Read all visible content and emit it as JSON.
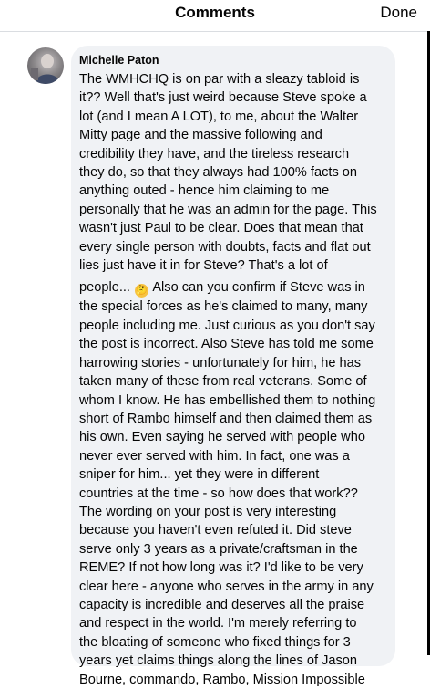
{
  "header": {
    "title": "Comments",
    "done_label": "Done"
  },
  "comment": {
    "author": "Michelle Paton",
    "lines": [
      "The WMHCHQ is on par with a sleazy tabloid is",
      "it?? Well that's just weird because Steve spoke a",
      "lot (and I mean A LOT), to me, about the Walter",
      "Mitty page and the massive following and",
      "credibility they have, and the tireless research",
      "they do, so that they always had 100% facts on",
      "anything outed - hence him claiming to me",
      "personally that he was an admin for the page. This",
      "wasn't just Paul to be clear. Does that mean that",
      "every single person with doubts, facts and flat out",
      "lies just have it in for Steve? That's a lot of"
    ],
    "line12_before": "people...",
    "emoji": "🤔",
    "line12_after": "Also can you confirm if Steve was in",
    "lines_after": [
      "the special forces as he's claimed to many, many",
      "people including me. Just curious as you don't say",
      "the post is incorrect. Also Steve has told me some",
      "harrowing stories - unfortunately for him, he has",
      "taken many of these from real veterans. Some of",
      "whom I know. He has embellished them to nothing",
      "short of Rambo himself and then claimed them as",
      "his own. Even saying he served with people who",
      "never ever served with him. In fact, one was a",
      "sniper for him... yet they were in different",
      "countries at the time - so how does that work??",
      "The wording on your post is very interesting",
      "because you haven't even refuted it. Did steve",
      "serve only 3 years as a private/craftsman in the",
      "REME? If not how long was it? I'd like to be very",
      "clear here - anyone who serves in the army in any",
      "capacity is incredible and deserves all the praise",
      "and respect in the world. I'm merely referring to",
      "the bloating of someone who fixed things for 3",
      "years yet claims things along the lines of Jason",
      "Bourne, commando, Rambo, Mission Impossible"
    ]
  }
}
